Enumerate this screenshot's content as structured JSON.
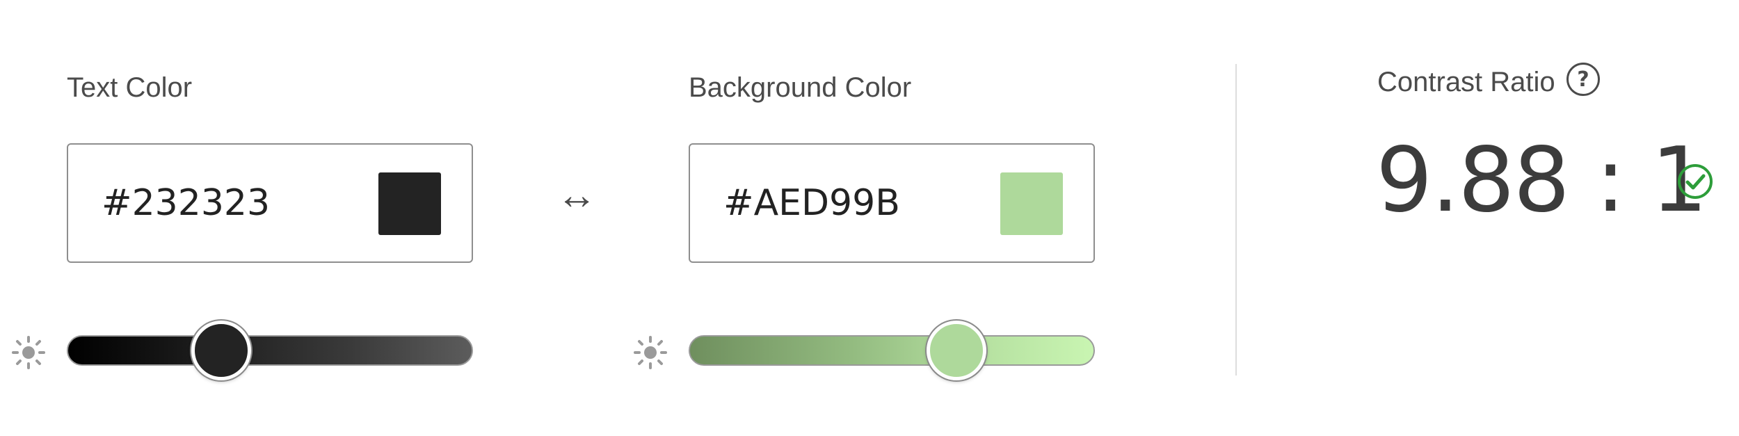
{
  "text_color": {
    "label": "Text Color",
    "hex_value": "#232323",
    "swatch_color": "#232323",
    "brightness_level": 0.38
  },
  "swap_icon": "left-right-arrow",
  "background_color": {
    "label": "Background Color",
    "hex_value": "#AED99B",
    "swatch_color": "#AED99B",
    "brightness_level": 0.66
  },
  "contrast": {
    "label": "Contrast Ratio",
    "help_icon": "question-circle",
    "ratio": "9.88 : 1",
    "status_icon": "check-circle",
    "status_color": "#2d9d3a"
  },
  "colors": {
    "label_text": "#4b4b4b",
    "border": "#8e8e8e",
    "divider": "#dddddd"
  }
}
